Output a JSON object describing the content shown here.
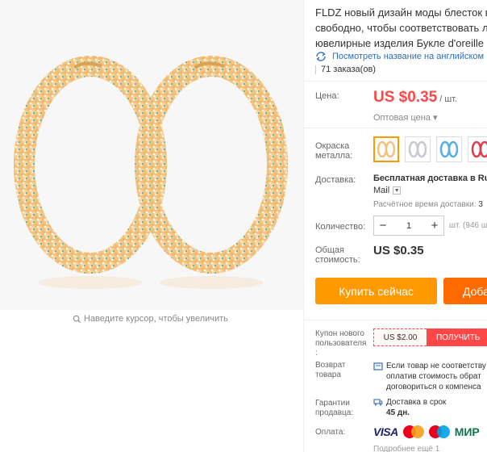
{
  "product": {
    "title_lines": [
      "FLDZ новый дизайн моды блесток в",
      "свободно, чтобы соответствовать ли",
      "ювелирные изделия Букле d'oreille"
    ],
    "translate_link": "Посмотреть название на английском",
    "orders": "71 заказа(ов)"
  },
  "gallery": {
    "zoom_hint": "Наведите курсор, чтобы увеличить"
  },
  "price": {
    "label": "Цена:",
    "value": "US $0.35",
    "unit": "/ шт.",
    "wholesale": "Оптовая цена ▾"
  },
  "color": {
    "label_line1": "Окраска",
    "label_line2": "металла:",
    "options": [
      {
        "name": "gold",
        "color": "#f2c27a",
        "selected": true
      },
      {
        "name": "silver",
        "color": "#c8c8d0"
      },
      {
        "name": "blue",
        "color": "#5aaee0"
      },
      {
        "name": "red",
        "color": "#e23b4b"
      }
    ]
  },
  "shipping": {
    "label": "Доставка:",
    "method": "Бесплатная доставка в Russ",
    "method_cont": "Mail",
    "time_label": "Расчётное время доставки:",
    "time_value": "3"
  },
  "quantity": {
    "label": "Количество:",
    "minus": "−",
    "value": "1",
    "plus": "+",
    "note": "шт. (946 ш"
  },
  "total": {
    "label_line1": "Общая",
    "label_line2": "стоимость:",
    "value": "US $0.35"
  },
  "buttons": {
    "buy_now": "Купить сейчас",
    "add_to_cart": "Доба"
  },
  "coupon": {
    "label_line1": "Купон нового",
    "label_line2": "пользователя",
    "label_line3": ":",
    "amount": "US $2.00",
    "get": "ПОЛУЧИТЬ"
  },
  "returns": {
    "label_line1": "Возврат",
    "label_line2": "товара",
    "line1": "Если товар не соответству",
    "line2": "оплатив стоимость обрат",
    "line3": "договориться о компенса"
  },
  "guarantee": {
    "label_line1": "Гарантии",
    "label_line2": "продавца:",
    "line1": "Доставка в срок",
    "line2": "45 дн."
  },
  "payment": {
    "label": "Оплата:",
    "visa": "VISA",
    "mir": "МИР",
    "last": "Подробнее ещё 1"
  }
}
